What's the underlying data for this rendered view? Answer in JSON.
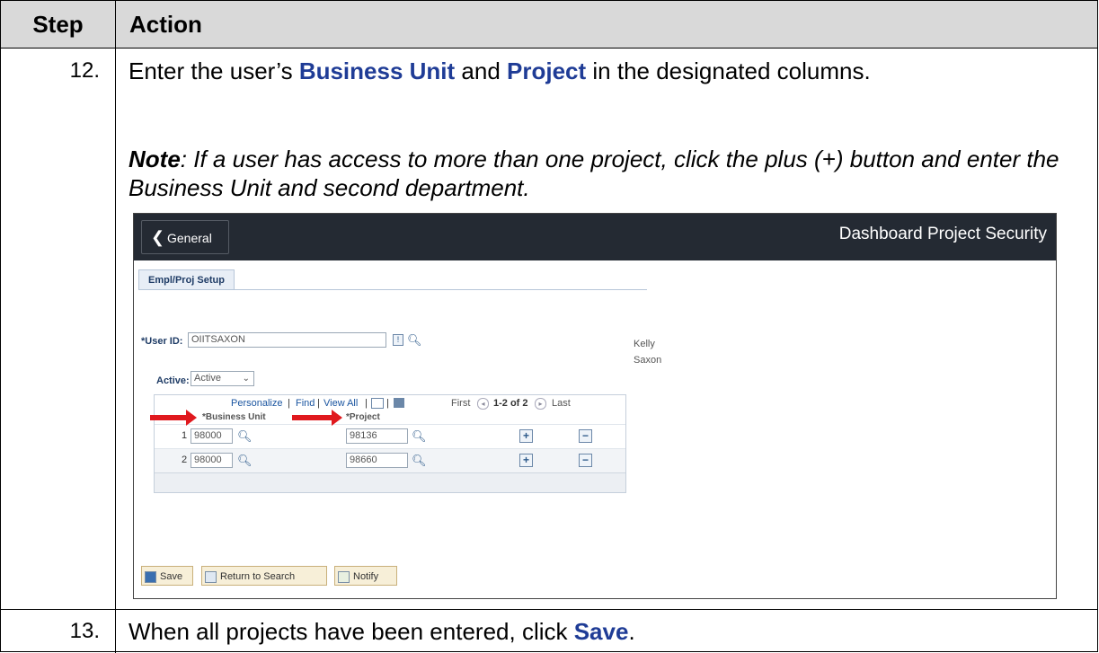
{
  "table": {
    "header_step": "Step",
    "header_action": "Action"
  },
  "step12": {
    "number": "12.",
    "pre": "Enter the user’s ",
    "bu": "Business Unit",
    "and": " and ",
    "project": "Project",
    "post": " in the designated columns.",
    "note_label": "Note",
    "note_text": ": If a user has access to more than one project, click the plus (+) button and enter the Business Unit and second department."
  },
  "step13": {
    "number": "13.",
    "pre": "When all projects have been entered, click ",
    "save": "Save",
    "post": "."
  },
  "screenshot": {
    "back_label": "General",
    "page_title": "Dashboard Project Security",
    "tab_label": "Empl/Proj Setup",
    "user_id_label": "*User ID:",
    "user_id_value": "OIITSAXON",
    "name_first": "Kelly",
    "name_last": "Saxon",
    "active_label": "Active:",
    "active_value": "Active",
    "grid_nav": {
      "personalize": "Personalize",
      "find": "Find",
      "view_all": "View All",
      "first": "First",
      "range": "1-2 of 2",
      "last": "Last"
    },
    "columns": [
      "*Business Unit",
      "*Project"
    ],
    "rows": [
      {
        "num": "1",
        "business_unit": "98000",
        "project": "98136"
      },
      {
        "num": "2",
        "business_unit": "98000",
        "project": "98660"
      }
    ],
    "buttons": {
      "save": "Save",
      "return": "Return to Search",
      "notify": "Notify"
    }
  },
  "colors": {
    "keyword_blue": "#1f3c96",
    "arrow_red": "#e0191e",
    "header_bg": "#d9d9d9",
    "topbar_bg": "#242a33"
  }
}
